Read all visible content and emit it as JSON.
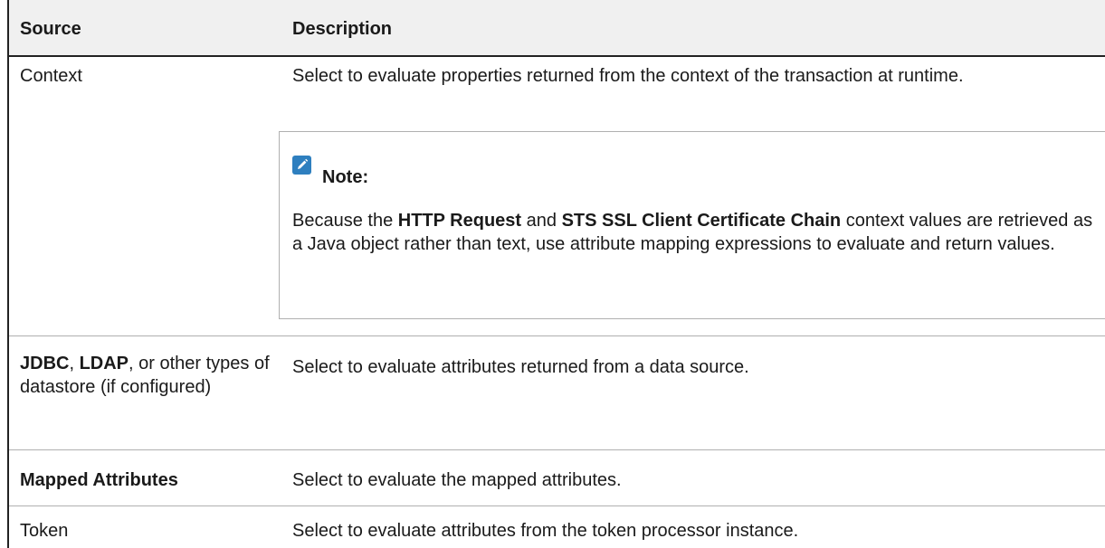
{
  "table": {
    "headers": {
      "source": "Source",
      "description": "Description"
    },
    "rows": [
      {
        "source": "Context",
        "description": "Select to evaluate properties returned from the context of the transaction at runtime.",
        "note": {
          "icon": "pencil-note-icon",
          "title": "Note:",
          "body_part1": "Because the ",
          "bold1": "HTTP Request",
          "body_part2": " and ",
          "bold2": "STS SSL Client Certificate Chain",
          "body_part3": " context values are retrieved as a Java object rather than text, use attribute mapping expressions to evaluate and return values."
        }
      },
      {
        "source_bold1": "JDBC",
        "source_sep": ", ",
        "source_bold2": "LDAP",
        "source_rest": ", or other types of datastore (if configured)",
        "description": "Select to evaluate attributes returned from a data source."
      },
      {
        "source_bold": "Mapped Attributes",
        "description": "Select to evaluate the mapped attributes."
      },
      {
        "source": "Token",
        "description": "Select to evaluate attributes from the token processor instance."
      }
    ]
  },
  "colors": {
    "header_bg": "#f0f0f0",
    "note_icon": "#2e7fbf",
    "border": "#222222",
    "row_divider": "#b0b0b0"
  }
}
